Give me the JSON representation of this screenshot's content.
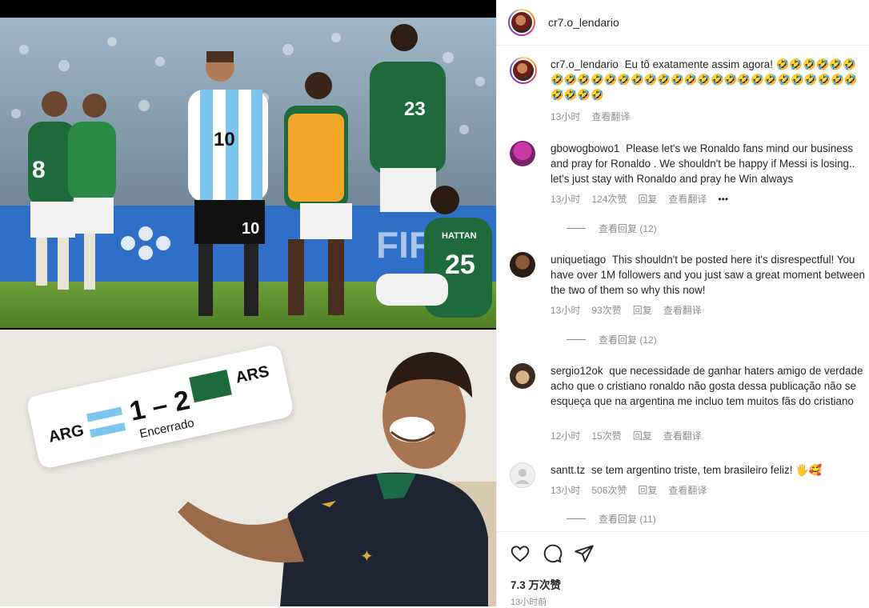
{
  "post": {
    "username": "cr7.o_lendario",
    "caption_user": "cr7.o_lendario",
    "caption_text": "Eu tô exatamente assim agora! 🤣🤣🤣🤣🤣🤣🤣🤣🤣🤣🤣🤣🤣🤣🤣🤣🤣🤣🤣🤣🤣🤣🤣🤣🤣🤣🤣🤣🤣🤣🤣🤣🤣",
    "caption_time": "13小时",
    "caption_translate": "查看翻译"
  },
  "scorecard": {
    "team_left": "ARG",
    "score": "1 – 2",
    "team_right": "ARS",
    "status": "Encerrado"
  },
  "comments": [
    {
      "user": "gbowogbowo1",
      "text": "Please let's we Ronaldo fans mind our business and pray for Ronaldo . We shouldn't be happy if Messi is losing.. let's just stay with Ronaldo and pray he Win always",
      "time": "13小时",
      "likes": "124次赞",
      "reply": "回复",
      "translate": "查看翻译",
      "more": "•••",
      "view_replies": "查看回复 (12)"
    },
    {
      "user": "uniquetiago",
      "text": "This shouldn't be posted here it's disrespectful! You have over 1M followers and you just saw a great moment between the two of them so why this now!",
      "time": "13小时",
      "likes": "93次赞",
      "reply": "回复",
      "translate": "查看翻译",
      "view_replies": "查看回复 (12)"
    },
    {
      "user": "sergio12ok",
      "text": "que necessidade de ganhar haters amigo de verdade acho que o cristiano ronaldo não gosta dessa publicação não se esqueça que na argentina me incluo tem muitos fãs do cristiano",
      "time": "12小时",
      "likes": "15次赞",
      "reply": "回复",
      "translate": "查看翻译"
    },
    {
      "user": "santt.tz",
      "text": "se tem argentino triste, tem brasileiro feliz! 🖐🥰",
      "time": "13小时",
      "likes": "506次赞",
      "reply": "回复",
      "translate": "查看翻译",
      "view_replies": "查看回复 (11)"
    }
  ],
  "footer": {
    "likes": "7.3 万次赞",
    "ago": "13小时前"
  },
  "jerseys": {
    "messi": "10",
    "saudi_a": "8",
    "saudi_b": "23",
    "saudi_c": "25",
    "saudi_c_name": "HATTAN"
  },
  "colors": {
    "saudi_green": "#1e6a3a",
    "argentina_blue": "#7cc6ee",
    "portugal_navy": "#1f2433",
    "link_blue": "#00376b"
  }
}
